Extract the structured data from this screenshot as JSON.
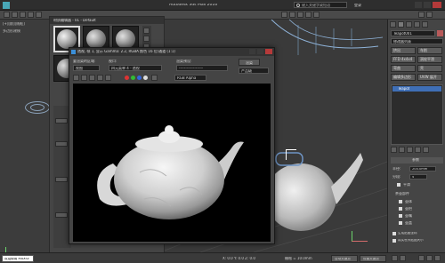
{
  "app": {
    "title": "Autodesk 3ds Max 2016",
    "search_placeholder": "键入关键字或短语",
    "sign_in": "登录",
    "mat_editor_title": "材质编辑器 - 01 - Default",
    "default_label": "默认"
  },
  "left": {
    "viewport_label": "[+][前][线框]",
    "sub_label": "多边形建模",
    "bottom_status": "欢迎使用 MAXSc"
  },
  "render_window": {
    "title": "透视, 帧 1, 显示 Gamma: 2.2, RGBA 颜色 16 位/通道 (1:1)",
    "area_label": "要渲染的区域:",
    "area_value": "视图",
    "viewport_label": "视口:",
    "viewport_value": "四元菜单 4 - 透视",
    "preset_label": "渲染预设:",
    "preset_value": "-------------------",
    "render_button": "渲染",
    "output_value": "产品级",
    "channel_value": "RGB Alpha"
  },
  "right_panel": {
    "object_name": "Teapot001",
    "modifier_list": "修改器列表",
    "buttons": [
      "挤出",
      "车削",
      "FFD 4x4x4",
      "涡轮平滑",
      "弯曲",
      "壳",
      "编辑多边形",
      "UVW 展开"
    ],
    "stack_item": "Teapot",
    "params_header": "参数",
    "radius_label": "半径:",
    "radius_value": "200.0mm",
    "segments_label": "分段:",
    "segments_value": "4",
    "smooth_label": "平滑",
    "parts_header": "茶壶部件",
    "parts": [
      "壶体",
      "壶把",
      "壶嘴",
      "壶盖"
    ],
    "gen_mapping": "生成贴图坐标",
    "real_world": "真实世界贴图大小"
  },
  "status": {
    "coords": "X: 0.0  Y: 0.0  Z: 0.0",
    "grid": "栅格 = 10.0mm",
    "add_time_tag": "添加时间标记",
    "auto_key": "自动关键点",
    "set_key": "设置关键点"
  }
}
